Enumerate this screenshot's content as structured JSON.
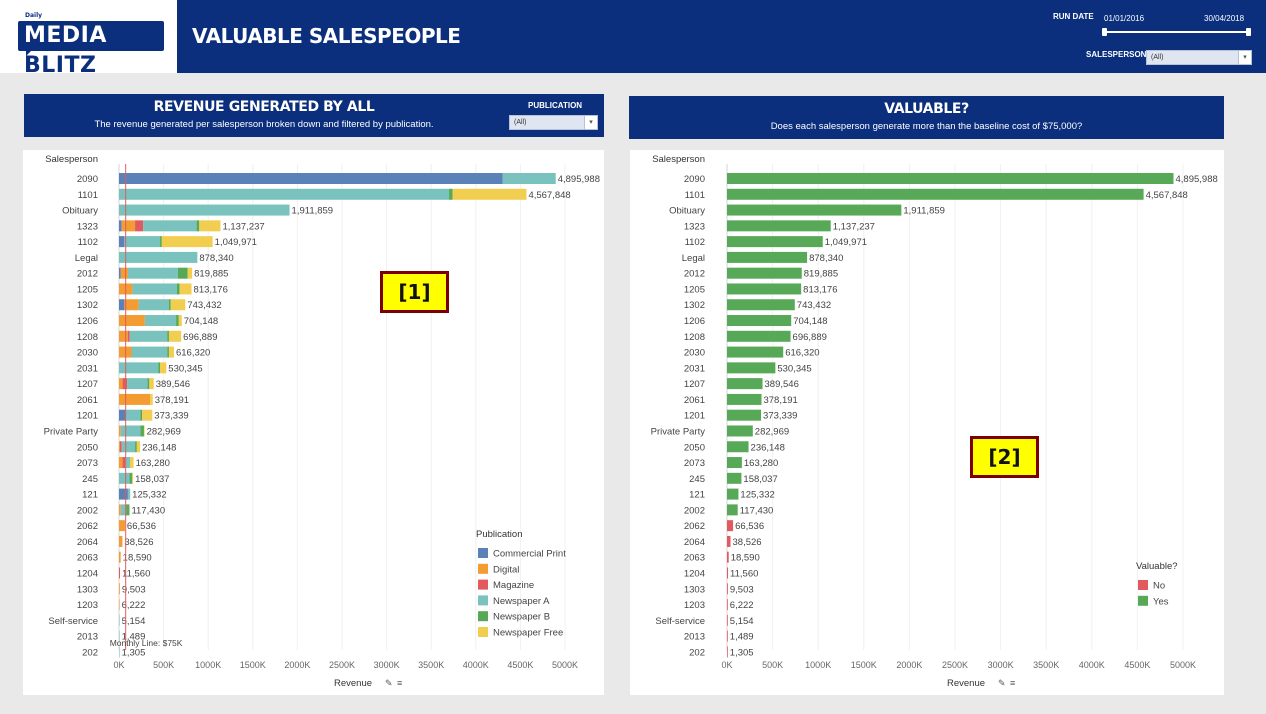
{
  "header": {
    "logo_small": "Daily",
    "logo_media": "MEDIA",
    "logo_blitz": "BLITZ",
    "title": "VALUABLE SALESPEOPLE",
    "run_date_label": "RUN DATE",
    "run_date_start": "01/01/2016",
    "run_date_end": "30/04/2018",
    "salesperson_label": "SALESPERSON",
    "salesperson_value": "(All)"
  },
  "left_panel": {
    "title": "REVENUE GENERATED BY ALL",
    "subtitle": "The revenue generated per salesperson broken down and filtered by publication.",
    "publication_label": "PUBLICATION",
    "publication_value": "(All)",
    "callout": "[1]",
    "legend_title": "Publication",
    "reference_line_label": "Monthly Line: $75K"
  },
  "right_panel": {
    "title": "VALUABLE?",
    "subtitle": "Does each salesperson generate more than the baseline cost of $75,000?",
    "callout": "[2]",
    "legend_title": "Valuable?"
  },
  "chart_data": [
    {
      "type": "bar",
      "orientation": "horizontal",
      "stacked": true,
      "ylabel": "Salesperson",
      "xlabel": "Revenue",
      "xlim": [
        0,
        5400000
      ],
      "xticks": [
        "0K",
        "500K",
        "1000K",
        "1500K",
        "2000K",
        "2500K",
        "3000K",
        "3500K",
        "4000K",
        "4500K",
        "5000K"
      ],
      "reference_line": {
        "value": 75000
      },
      "categories": [
        "2090",
        "1101",
        "Obituary",
        "1323",
        "1102",
        "Legal",
        "2012",
        "1205",
        "1302",
        "1206",
        "1208",
        "2030",
        "2031",
        "1207",
        "2061",
        "1201",
        "Private Party",
        "2050",
        "2073",
        "245",
        "121",
        "2002",
        "2062",
        "2064",
        "2063",
        "1204",
        "1303",
        "1203",
        "Self-service",
        "2013",
        "202"
      ],
      "totals": [
        4895988,
        4567848,
        1911859,
        1137237,
        1049971,
        878340,
        819885,
        813176,
        743432,
        704148,
        696889,
        616320,
        530345,
        389546,
        378191,
        373339,
        282969,
        236148,
        163280,
        158037,
        125332,
        117430,
        66536,
        38526,
        18590,
        11560,
        9503,
        6222,
        5154,
        1489,
        1305
      ],
      "total_labels": [
        "4,895,988",
        "4,567,848",
        "1,911,859",
        "1,137,237",
        "1,049,971",
        "878,340",
        "819,885",
        "813,176",
        "743,432",
        "704,148",
        "696,889",
        "616,320",
        "530,345",
        "389,546",
        "378,191",
        "373,339",
        "282,969",
        "236,148",
        "163,280",
        "158,037",
        "125,332",
        "117,430",
        "66,536",
        "38,526",
        "18,590",
        "11,560",
        "9,503",
        "6,222",
        "5,154",
        "1,489",
        "1,305"
      ],
      "series": [
        {
          "name": "Commercial Print",
          "color": "#5b82b8",
          "values": [
            4300000,
            0,
            0,
            30000,
            60000,
            0,
            20000,
            0,
            60000,
            0,
            0,
            0,
            0,
            0,
            0,
            80000,
            0,
            0,
            0,
            0,
            100000,
            0,
            0,
            0,
            0,
            0,
            0,
            0,
            0,
            0,
            0
          ]
        },
        {
          "name": "Digital",
          "color": "#f39c34",
          "values": [
            0,
            0,
            0,
            150000,
            0,
            0,
            80000,
            150000,
            160000,
            290000,
            100000,
            140000,
            0,
            40000,
            350000,
            0,
            20000,
            10000,
            40000,
            0,
            0,
            20000,
            66536,
            38526,
            18590,
            0,
            9503,
            6222,
            0,
            0,
            0
          ]
        },
        {
          "name": "Magazine",
          "color": "#e15b5e",
          "values": [
            0,
            0,
            0,
            90000,
            0,
            0,
            0,
            0,
            0,
            0,
            20000,
            0,
            0,
            50000,
            0,
            0,
            0,
            20000,
            30000,
            0,
            0,
            0,
            0,
            0,
            0,
            11560,
            0,
            0,
            0,
            0,
            0
          ]
        },
        {
          "name": "Newspaper A",
          "color": "#79c2bd",
          "values": [
            595988,
            3700000,
            1911859,
            600000,
            400000,
            878340,
            560000,
            500000,
            340000,
            350000,
            420000,
            400000,
            440000,
            230000,
            0,
            160000,
            220000,
            150000,
            53280,
            118037,
            25332,
            60000,
            0,
            0,
            0,
            0,
            0,
            0,
            5154,
            1489,
            1305
          ]
        },
        {
          "name": "Newspaper B",
          "color": "#58a957",
          "values": [
            0,
            40000,
            0,
            30000,
            20000,
            0,
            110000,
            30000,
            20000,
            30000,
            20000,
            20000,
            20000,
            20000,
            0,
            20000,
            40000,
            20000,
            0,
            30000,
            0,
            37430,
            0,
            0,
            0,
            0,
            0,
            0,
            0,
            0,
            0
          ]
        },
        {
          "name": "Newspaper Free",
          "color": "#f1ce4f",
          "values": [
            0,
            827848,
            0,
            237237,
            569971,
            0,
            49885,
            133176,
            163432,
            34148,
            136889,
            56320,
            70345,
            49546,
            28191,
            113339,
            2969,
            36148,
            40000,
            10000,
            0,
            0,
            0,
            0,
            0,
            0,
            0,
            0,
            0,
            0,
            0
          ]
        }
      ]
    },
    {
      "type": "bar",
      "orientation": "horizontal",
      "ylabel": "Salesperson",
      "xlabel": "Revenue",
      "xlim": [
        0,
        5400000
      ],
      "xticks": [
        "0K",
        "500K",
        "1000K",
        "1500K",
        "2000K",
        "2500K",
        "3000K",
        "3500K",
        "4000K",
        "4500K",
        "5000K"
      ],
      "threshold": 75000,
      "categories": [
        "2090",
        "1101",
        "Obituary",
        "1323",
        "1102",
        "Legal",
        "2012",
        "1205",
        "1302",
        "1206",
        "1208",
        "2030",
        "2031",
        "1207",
        "2061",
        "1201",
        "Private Party",
        "2050",
        "2073",
        "245",
        "121",
        "2002",
        "2062",
        "2064",
        "2063",
        "1204",
        "1303",
        "1203",
        "Self-service",
        "2013",
        "202"
      ],
      "values": [
        4895988,
        4567848,
        1911859,
        1137237,
        1049971,
        878340,
        819885,
        813176,
        743432,
        704148,
        696889,
        616320,
        530345,
        389546,
        378191,
        373339,
        282969,
        236148,
        163280,
        158037,
        125332,
        117430,
        66536,
        38526,
        18590,
        11560,
        9503,
        6222,
        5154,
        1489,
        1305
      ],
      "value_labels": [
        "4,895,988",
        "4,567,848",
        "1,911,859",
        "1,137,237",
        "1,049,971",
        "878,340",
        "819,885",
        "813,176",
        "743,432",
        "704,148",
        "696,889",
        "616,320",
        "530,345",
        "389,546",
        "378,191",
        "373,339",
        "282,969",
        "236,148",
        "163,280",
        "158,037",
        "125,332",
        "117,430",
        "66,536",
        "38,526",
        "18,590",
        "11,560",
        "9,503",
        "6,222",
        "5,154",
        "1,489",
        "1,305"
      ],
      "series": [
        {
          "name": "No",
          "color": "#e15b5e"
        },
        {
          "name": "Yes",
          "color": "#58a957"
        }
      ]
    }
  ]
}
